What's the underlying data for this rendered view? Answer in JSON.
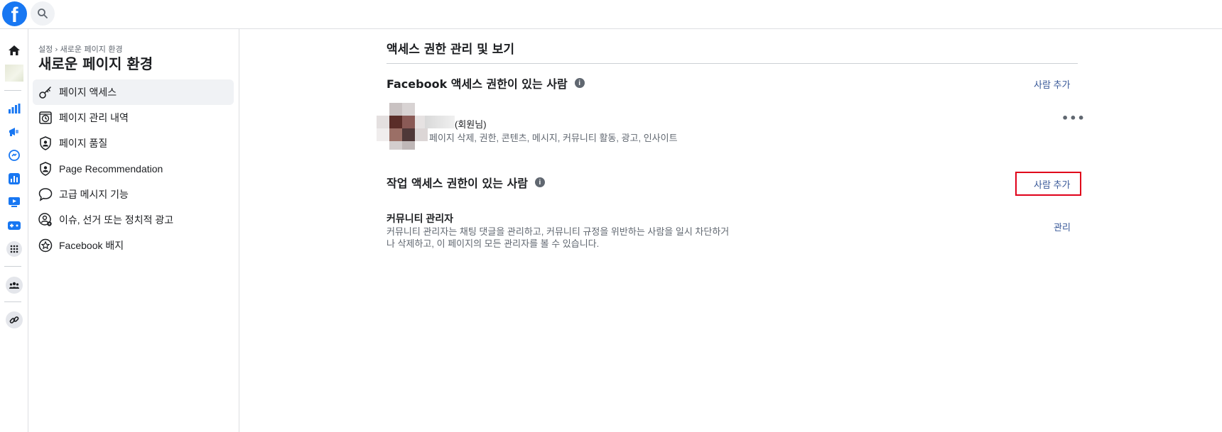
{
  "topbar": {
    "logo_letter": "f",
    "logo_icon": "facebook-logo",
    "search_icon": "search-icon"
  },
  "rail": {
    "items": [
      {
        "icon": "home-icon"
      },
      {
        "icon": "page-thumbnail"
      },
      {
        "icon": "insights-icon"
      },
      {
        "icon": "megaphone-icon"
      },
      {
        "icon": "messenger-icon"
      },
      {
        "icon": "analytics-icon"
      },
      {
        "icon": "video-icon"
      },
      {
        "icon": "gaming-icon"
      },
      {
        "icon": "grid-icon"
      },
      {
        "icon": "groups-icon"
      },
      {
        "icon": "link-icon"
      }
    ]
  },
  "sidebar": {
    "breadcrumb": {
      "root": "설정",
      "separator": "›",
      "current": "새로운 페이지 환경"
    },
    "title": "새로운 페이지 환경",
    "items": [
      {
        "label": "페이지 액세스",
        "icon": "key-icon",
        "active": true
      },
      {
        "label": "페이지 관리 내역",
        "icon": "history-icon",
        "active": false
      },
      {
        "label": "페이지 품질",
        "icon": "shield-person-icon",
        "active": false
      },
      {
        "label": "Page Recommendation",
        "icon": "shield-person-icon",
        "active": false
      },
      {
        "label": "고급 메시지 기능",
        "icon": "chat-bubble-icon",
        "active": false
      },
      {
        "label": "이슈, 선거 또는 정치적 광고",
        "icon": "person-gear-icon",
        "active": false
      },
      {
        "label": "Facebook 배지",
        "icon": "star-badge-icon",
        "active": false
      }
    ]
  },
  "main": {
    "title": "액세스 권한 관리 및 보기",
    "facebook_access": {
      "title": "Facebook 액세스 권한이 있는 사람",
      "info_glyph": "i",
      "add_label": "사람 추가",
      "member": {
        "name": "(회원님)",
        "permissions": "페이지 삭제, 권한, 콘텐츠, 메시지, 커뮤니티 활동, 광고, 인사이트",
        "more_glyph": "•••"
      }
    },
    "task_access": {
      "title": "작업 액세스 권한이 있는 사람",
      "info_glyph": "i",
      "add_label": "사람 추가"
    },
    "community_manager": {
      "title": "커뮤니티 관리자",
      "description_line1": "커뮤니티 관리자는 채팅 댓글을 관리하고, 커뮤니티 규정을 위반하는 사람을 일시 차단하거",
      "description_line2": "나 삭제하고, 이 페이지의 모든 관리자를 볼 수 있습니다.",
      "manage_label": "관리"
    }
  },
  "colors": {
    "brand": "#1877f2",
    "link": "#385898",
    "highlight": "#e0001a"
  }
}
